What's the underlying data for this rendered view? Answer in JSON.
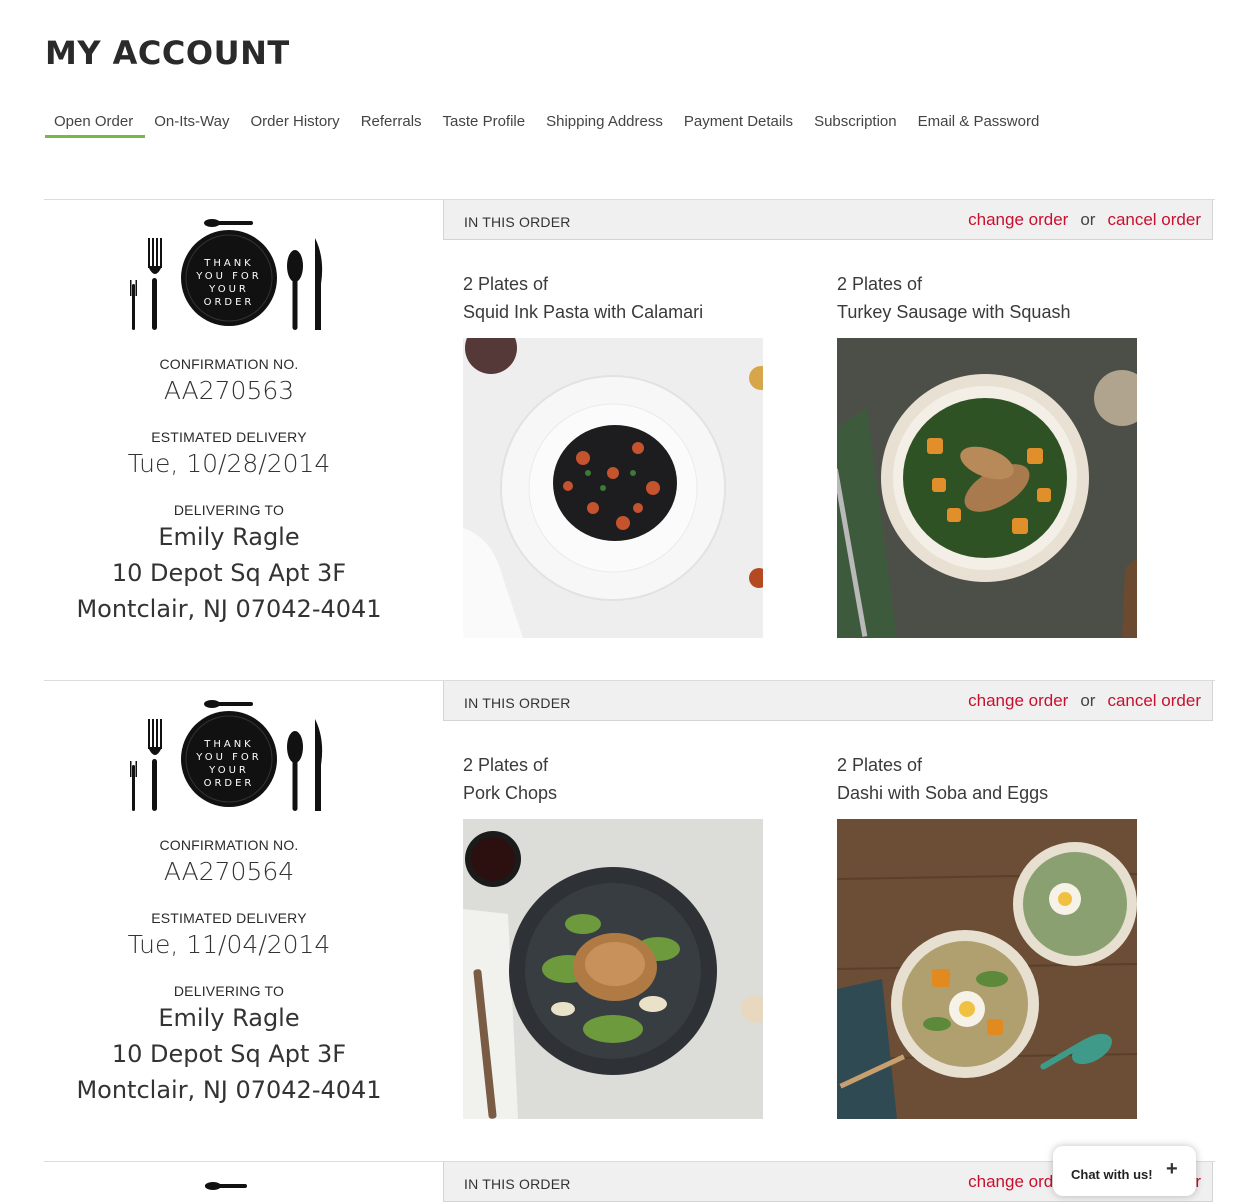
{
  "page": {
    "title": "MY ACCOUNT"
  },
  "tabs": [
    {
      "label": "Open Order",
      "active": true
    },
    {
      "label": "On-Its-Way"
    },
    {
      "label": "Order History"
    },
    {
      "label": "Referrals"
    },
    {
      "label": "Taste Profile"
    },
    {
      "label": "Shipping Address"
    },
    {
      "label": "Payment Details"
    },
    {
      "label": "Subscription"
    },
    {
      "label": "Email & Password"
    }
  ],
  "logo_text": [
    "THANK",
    "YOU FOR",
    "YOUR",
    "ORDER"
  ],
  "labels": {
    "confirmation": "CONFIRMATION NO.",
    "estimated_delivery": "ESTIMATED DELIVERY",
    "delivering_to": "DELIVERING TO",
    "in_this_order": "IN THIS ORDER",
    "change_order": "change order",
    "or": "or",
    "cancel_order": "cancel order"
  },
  "orders": [
    {
      "confirmation_no": "AA270563",
      "delivery_date": "Tue, 10/28/2014",
      "name": "Emily Ragle",
      "address1": "10 Depot Sq Apt 3F",
      "address2": "Montclair, NJ 07042-4041",
      "meals": [
        {
          "qty": "2 Plates of",
          "title": "Squid Ink Pasta with Calamari",
          "photo": "pasta-plate"
        },
        {
          "qty": "2 Plates of",
          "title": "Turkey Sausage with Squash",
          "photo": "sausage-bowl"
        }
      ]
    },
    {
      "confirmation_no": "AA270564",
      "delivery_date": "Tue, 11/04/2014",
      "name": "Emily Ragle",
      "address1": "10 Depot Sq Apt 3F",
      "address2": "Montclair, NJ 07042-4041",
      "meals": [
        {
          "qty": "2 Plates of",
          "title": "Pork Chops",
          "photo": "pork-plate"
        },
        {
          "qty": "2 Plates of",
          "title": "Dashi with Soba and Eggs",
          "photo": "dashi-bowls"
        }
      ]
    }
  ],
  "chat": {
    "label": "Chat with us!",
    "icon": "plus-icon"
  },
  "colors": {
    "accent_green": "#7ab648",
    "link_red": "#c8102e",
    "bar_bg": "#f0f0f0"
  }
}
